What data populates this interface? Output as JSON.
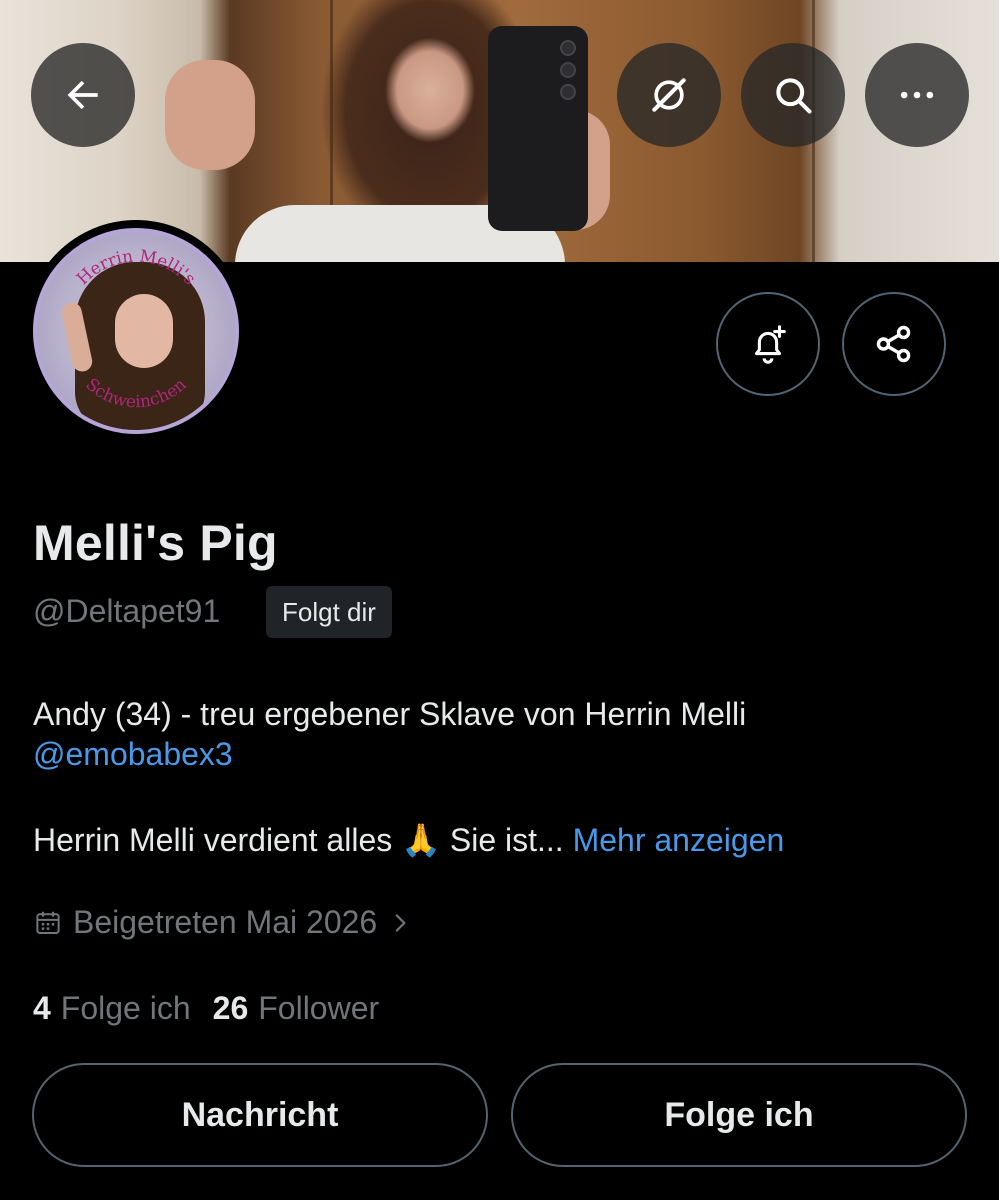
{
  "header": {
    "back_icon": "arrow-left-icon",
    "grok_icon": "grok-icon",
    "search_icon": "search-icon",
    "more_icon": "more-horizontal-icon"
  },
  "avatar": {
    "ring_text_top": "Herrin Melli's",
    "ring_text_bottom": "Schweinchen"
  },
  "actions": {
    "notify_icon": "bell-plus-icon",
    "share_icon": "share-icon"
  },
  "profile": {
    "display_name": "Melli's Pig",
    "handle": "@Deltapet91",
    "follows_you": "Folgt dir",
    "bio_line1": "Andy (34) - treu ergebener Sklave von Herrin Melli",
    "bio_mention": "@emobabex3",
    "bio_line2_text": "Herrin Melli verdient alles 🙏 Sie ist...",
    "show_more": "Mehr anzeigen",
    "joined": "Beigetreten Mai 2026",
    "following_count": "4",
    "following_label": "Folge ich",
    "followers_count": "26",
    "followers_label": "Follower"
  },
  "buttons": {
    "message": "Nachricht",
    "following": "Folge ich"
  },
  "colors": {
    "background": "#000000",
    "text": "#e7e9ea",
    "muted": "#71767b",
    "link": "#4a99e9",
    "border": "#536471"
  }
}
